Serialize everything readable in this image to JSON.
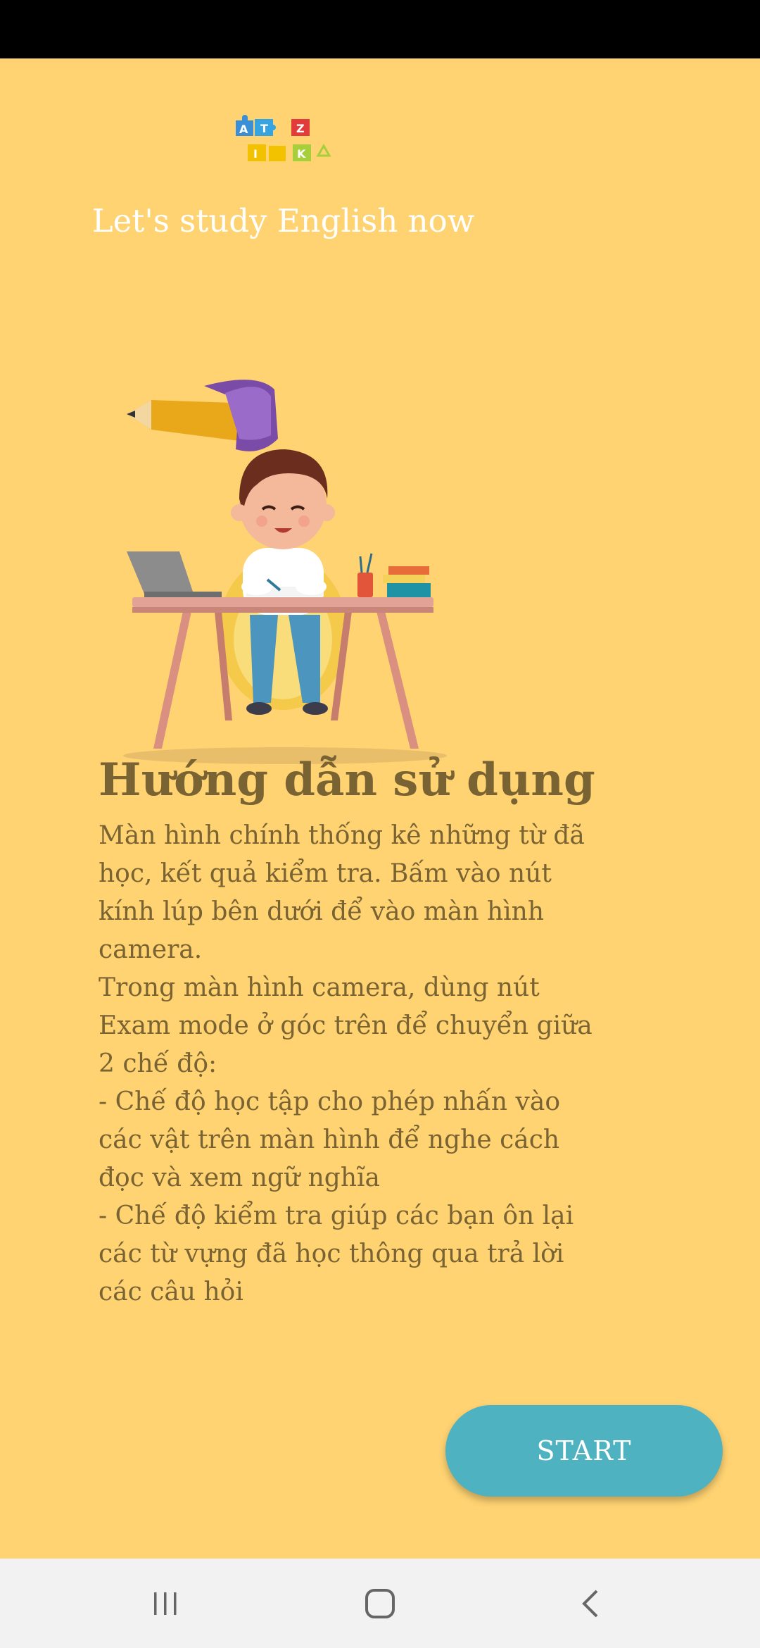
{
  "header": {
    "logo_name": "puzzle-letters-logo",
    "tagline": "Let's study English now"
  },
  "illustration": {
    "description_icon": "kid-studying-illustration"
  },
  "guide": {
    "title": "Hướng dẫn sử dụng",
    "paragraphs": [
      "   Màn hình chính thống kê những từ đã học, kết quả kiểm tra. Bấm vào nút kính lúp bên dưới để vào màn hình camera.",
      "   Trong màn hình camera, dùng nút Exam mode ở góc trên để chuyển giữa 2 chế độ:",
      "          - Chế độ học tập cho phép nhấn vào các vật trên màn hình để nghe cách đọc và xem ngữ nghĩa",
      "          - Chế độ kiểm tra giúp các bạn ôn lại các từ vựng đã học thông qua trả lời các câu hỏi"
    ]
  },
  "start_button": {
    "label": "START"
  },
  "navbar": {
    "icons": [
      "recent-apps-icon",
      "home-icon",
      "back-icon"
    ]
  },
  "colors": {
    "background": "#FFD372",
    "text_brown": "#7A6332",
    "button": "#4FB2C1",
    "status_bar": "#000000",
    "nav_bar": "#F2F2F2"
  }
}
